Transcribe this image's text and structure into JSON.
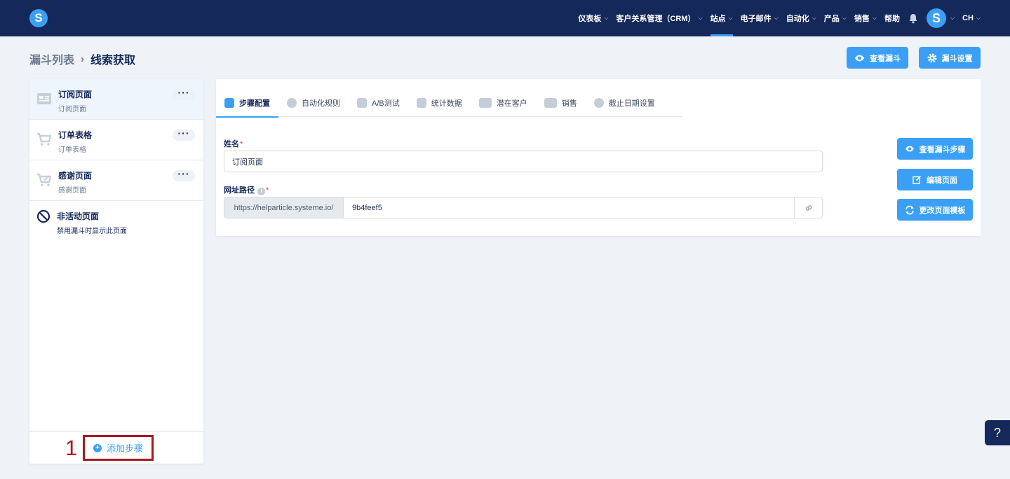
{
  "brand": {
    "logo_letter": "S",
    "accent": "#3ba0f5",
    "navy": "#15285a"
  },
  "nav": {
    "items": [
      {
        "label": "仪表板",
        "has_chevron": true
      },
      {
        "label": "客户关系管理（CRM）",
        "has_chevron": true
      },
      {
        "label": "站点",
        "has_chevron": true,
        "active": true
      },
      {
        "label": "电子邮件",
        "has_chevron": true
      },
      {
        "label": "自动化",
        "has_chevron": true
      },
      {
        "label": "产品",
        "has_chevron": true
      },
      {
        "label": "销售",
        "has_chevron": true
      },
      {
        "label": "帮助",
        "has_chevron": false
      }
    ],
    "avatar_letter": "S",
    "language": "CH"
  },
  "breadcrumb": {
    "parent": "漏斗列表",
    "separator": "›",
    "current": "线索获取"
  },
  "header_buttons": {
    "view_funnel": "查看漏斗",
    "funnel_settings": "漏斗设置"
  },
  "steps": [
    {
      "title": "订阅页面",
      "subtitle": "订阅页面",
      "icon": "page-layout-icon",
      "active": true
    },
    {
      "title": "订单表格",
      "subtitle": "订单表格",
      "icon": "cart-icon"
    },
    {
      "title": "感谢页面",
      "subtitle": "感谢页面",
      "icon": "cart-check-icon"
    }
  ],
  "inactive_pages": {
    "title": "非活动页面",
    "subtitle": "禁用漏斗时显示此页面"
  },
  "add_step": {
    "label": "添加步骤",
    "annotation": "1"
  },
  "tabs": [
    {
      "label": "步骤配置",
      "active": true
    },
    {
      "label": "自动化规则"
    },
    {
      "label": "A/B测试"
    },
    {
      "label": "统计数据"
    },
    {
      "label": "潜在客户"
    },
    {
      "label": "销售"
    },
    {
      "label": "截止日期设置"
    }
  ],
  "form": {
    "name_label": "姓名",
    "name_value": "订阅页面",
    "url_label": "网址路径",
    "required_mark": "*",
    "info_mark": "!",
    "url_prefix": "https://helparticle.systeme.io/",
    "url_value": "9b4feef5"
  },
  "side_buttons": {
    "view_step": "查看漏斗步骤",
    "edit_page": "编辑页面",
    "change_template": "更改页面模板"
  },
  "help": {
    "label": "?"
  }
}
